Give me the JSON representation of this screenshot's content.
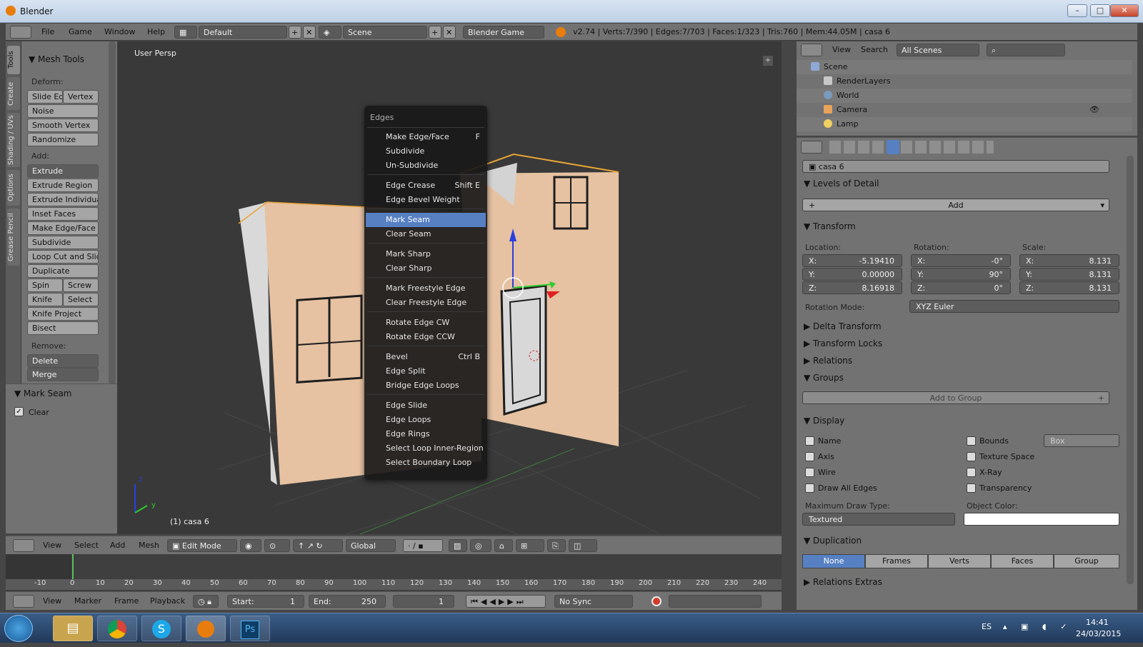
{
  "window": {
    "title": "Blender",
    "min": "–",
    "max": "□",
    "close": "✕"
  },
  "topbar": {
    "menus": [
      "File",
      "Game",
      "Window",
      "Help"
    ],
    "screen_layout": "Default",
    "scene": "Scene",
    "engine": "Blender Game",
    "info": "v2.74 | Verts:7/390 | Edges:7/703 | Faces:1/323 | Tris:760 | Mem:44.05M | casa 6"
  },
  "tool_tabs": [
    "Tools",
    "Create",
    "Shading / UVs",
    "Options",
    "Grease Pencil"
  ],
  "toolshelf": {
    "panel_title": "Mesh Tools",
    "deform_label": "Deform:",
    "slide_edge": "Slide Ed",
    "vertex": "Vertex",
    "noise": "Noise",
    "smooth_vertex": "Smooth Vertex",
    "randomize": "Randomize",
    "add_label": "Add:",
    "extrude": "Extrude",
    "extrude_region": "Extrude Region",
    "extrude_individual": "Extrude Individual",
    "inset_faces": "Inset Faces",
    "make_edge_face": "Make Edge/Face",
    "subdivide": "Subdivide",
    "loop_cut": "Loop Cut and Slide",
    "duplicate": "Duplicate",
    "spin": "Spin",
    "screw": "Screw",
    "knife": "Knife",
    "select": "Select",
    "knife_project": "Knife Project",
    "bisect": "Bisect",
    "remove_label": "Remove:",
    "delete": "Delete",
    "merge": "Merge"
  },
  "last_operator": {
    "title": "Mark Seam",
    "clear_label": "Clear",
    "clear_checked": true
  },
  "viewport": {
    "view_name": "User Persp",
    "object_label": "(1) casa 6",
    "axis_y": "y",
    "axis_z": "z"
  },
  "context_menu": {
    "title": "Edges",
    "items": [
      {
        "label": "Make Edge/Face",
        "shortcut": "F"
      },
      {
        "label": "Subdivide",
        "shortcut": ""
      },
      {
        "label": "Un-Subdivide",
        "shortcut": ""
      },
      {
        "label": "Edge Crease",
        "shortcut": "Shift E"
      },
      {
        "label": "Edge Bevel Weight",
        "shortcut": ""
      },
      {
        "label": "Mark Seam",
        "shortcut": ""
      },
      {
        "label": "Clear Seam",
        "shortcut": ""
      },
      {
        "label": "Mark Sharp",
        "shortcut": ""
      },
      {
        "label": "Clear Sharp",
        "shortcut": ""
      },
      {
        "label": "Mark Freestyle Edge",
        "shortcut": ""
      },
      {
        "label": "Clear Freestyle Edge",
        "shortcut": ""
      },
      {
        "label": "Rotate Edge CW",
        "shortcut": ""
      },
      {
        "label": "Rotate Edge CCW",
        "shortcut": ""
      },
      {
        "label": "Bevel",
        "shortcut": "Ctrl B"
      },
      {
        "label": "Edge Split",
        "shortcut": ""
      },
      {
        "label": "Bridge Edge Loops",
        "shortcut": ""
      },
      {
        "label": "Edge Slide",
        "shortcut": ""
      },
      {
        "label": "Edge Loops",
        "shortcut": ""
      },
      {
        "label": "Edge Rings",
        "shortcut": ""
      },
      {
        "label": "Select Loop Inner-Region",
        "shortcut": ""
      },
      {
        "label": "Select Boundary Loop",
        "shortcut": ""
      }
    ],
    "highlighted": "Mark Seam"
  },
  "view3d_header": {
    "menus": [
      "View",
      "Select",
      "Add",
      "Mesh"
    ],
    "mode": "Edit Mode",
    "orientation": "Global"
  },
  "timeline": {
    "ticks": [
      "-10",
      "0",
      "10",
      "20",
      "30",
      "40",
      "50",
      "60",
      "70",
      "80",
      "90",
      "100",
      "110",
      "120",
      "130",
      "140",
      "150",
      "160",
      "170",
      "180",
      "190",
      "200",
      "210",
      "220",
      "230",
      "240"
    ],
    "menus": [
      "View",
      "Marker",
      "Frame",
      "Playback"
    ],
    "start_label": "Start:",
    "start": "1",
    "end_label": "End:",
    "end": "250",
    "current": "1",
    "sync": "No Sync"
  },
  "outliner": {
    "menus": [
      "View",
      "Search"
    ],
    "filter": "All Scenes",
    "rows": [
      "Scene",
      "RenderLayers",
      "World",
      "Camera",
      "Lamp"
    ]
  },
  "properties": {
    "object_name": "casa 6",
    "lod_title": "Levels of Detail",
    "lod_add": "Add",
    "transform_title": "Transform",
    "location_label": "Location:",
    "rotation_label": "Rotation:",
    "scale_label": "Scale:",
    "axis": [
      "X:",
      "Y:",
      "Z:"
    ],
    "location": [
      "-5.19410",
      "0.00000",
      "8.16918"
    ],
    "rotation": [
      "-0°",
      "90°",
      "0°"
    ],
    "scale": [
      "8.131",
      "8.131",
      "8.131"
    ],
    "rotation_mode_label": "Rotation Mode:",
    "rotation_mode": "XYZ Euler",
    "delta_transform": "Delta Transform",
    "transform_locks": "Transform Locks",
    "relations": "Relations",
    "groups": "Groups",
    "add_to_group": "Add to Group",
    "display": "Display",
    "display_left": [
      "Name",
      "Axis",
      "Wire",
      "Draw All Edges"
    ],
    "display_right": [
      "Bounds",
      "Texture Space",
      "X-Ray",
      "Transparency"
    ],
    "bounds_type": "Box",
    "max_draw_label": "Maximum Draw Type:",
    "max_draw": "Textured",
    "object_color_label": "Object Color:",
    "duplication": "Duplication",
    "dup_options": [
      "None",
      "Frames",
      "Verts",
      "Faces",
      "Group"
    ],
    "dup_selected": "None",
    "relations_extras": "Relations Extras"
  },
  "taskbar": {
    "lang": "ES",
    "time": "14:41",
    "date": "24/03/2015",
    "ps_label": "Ps"
  }
}
